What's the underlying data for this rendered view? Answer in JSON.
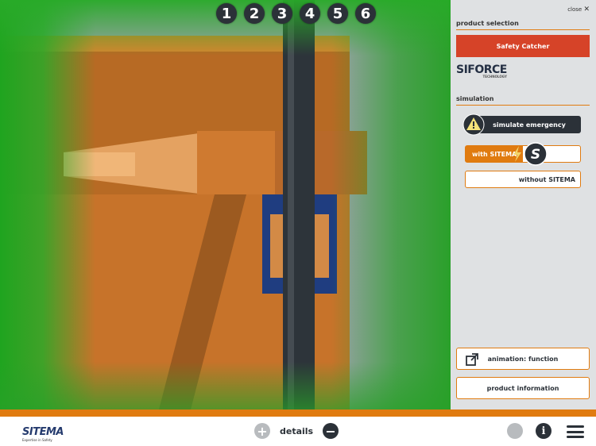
{
  "nav": {
    "steps": [
      "1",
      "2",
      "3",
      "4",
      "5",
      "6"
    ]
  },
  "panel": {
    "close_label": "close",
    "product_selection_title": "product selection",
    "product_selected": "Safety Catcher",
    "brand_logo": "SIFORCE",
    "brand_logo_tagline": "TECHNOLOGY",
    "simulation_title": "simulation",
    "simulate_emergency_label": "simulate emergency",
    "with_sitema_label": "with SITEMA",
    "without_sitema_label": "without SITEMA",
    "animation_label": "animation: function",
    "product_info_label": "product information"
  },
  "footer": {
    "logo_text": "SITEMA",
    "logo_tagline": "Expertise in Safety",
    "details_label": "details"
  },
  "colors": {
    "accent_orange": "#e07b10",
    "product_red": "#d64328",
    "dark": "#2b3138",
    "scene_green": "#2aa02a",
    "wood": "#c7732a"
  },
  "icons": [
    "warning-icon",
    "lightning-icon",
    "s-logo-icon",
    "external-link-icon",
    "plus-icon",
    "minus-icon",
    "globe-icon",
    "info-icon",
    "menu-icon",
    "close-icon"
  ]
}
